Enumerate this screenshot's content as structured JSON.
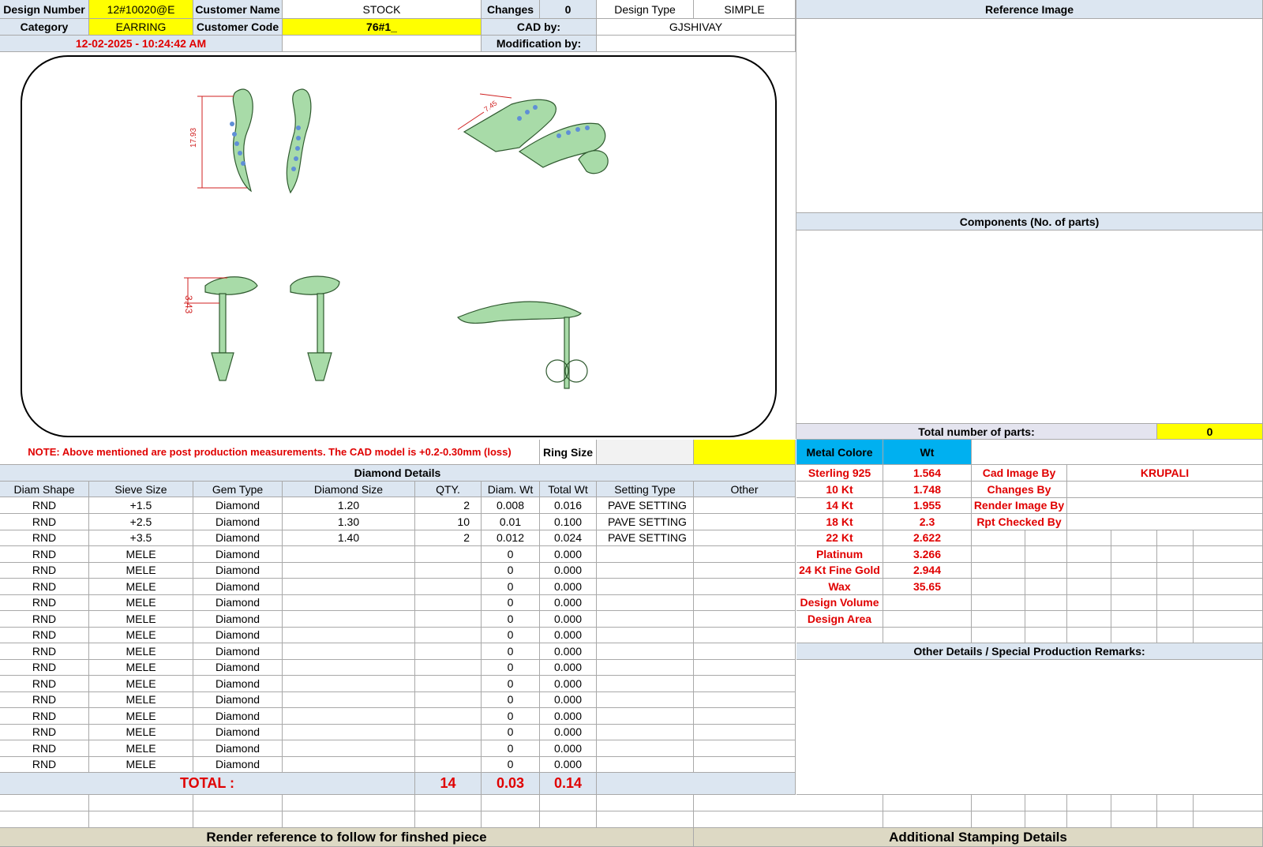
{
  "header": {
    "design_number_label": "Design Number",
    "design_number": "12#10020@E",
    "customer_name_label": "Customer Name",
    "customer_name": "STOCK",
    "changes_label": "Changes",
    "changes": "0",
    "design_type_label": "Design Type",
    "design_type": "SIMPLE",
    "category_label": "Category",
    "category": "EARRING",
    "customer_code_label": "Customer Code",
    "customer_code": "76#1_",
    "cad_by_label": "CAD by:",
    "cad_by": "GJSHIVAY",
    "timestamp": "12-02-2025 - 10:24:42 AM",
    "modification_by_label": "Modification by:"
  },
  "render": {
    "dim_front": "17.93",
    "dim_side": "3.43",
    "dim_angle": "7.45"
  },
  "right_panel": {
    "reference_image_title": "Reference Image",
    "components_title": "Components (No. of parts)",
    "total_parts_label": "Total number of parts:",
    "total_parts": "0"
  },
  "note": "NOTE: Above mentioned are post production measurements. The CAD model is +0.2-0.30mm (loss)",
  "ring_size_label": "Ring Size",
  "metal": {
    "header_label": "Metal Colore",
    "wt_label": "Wt",
    "rows": [
      {
        "name": "Sterling 925",
        "wt": "1.564"
      },
      {
        "name": "10 Kt",
        "wt": "1.748"
      },
      {
        "name": "14 Kt",
        "wt": "1.955"
      },
      {
        "name": "18 Kt",
        "wt": "2.3"
      },
      {
        "name": "22 Kt",
        "wt": "2.622"
      },
      {
        "name": "Platinum",
        "wt": "3.266"
      },
      {
        "name": "24 Kt Fine Gold",
        "wt": "2.944"
      },
      {
        "name": "Wax",
        "wt": "35.65"
      },
      {
        "name": "Design Volume",
        "wt": ""
      },
      {
        "name": "Design Area",
        "wt": ""
      }
    ]
  },
  "credits": [
    {
      "label": "Cad Image By",
      "value": "KRUPALI"
    },
    {
      "label": "Changes By",
      "value": ""
    },
    {
      "label": "Render Image By",
      "value": ""
    },
    {
      "label": "Rpt Checked By",
      "value": ""
    }
  ],
  "other_details_title": "Other Details / Special Production Remarks:",
  "diamond": {
    "title": "Diamond Details",
    "columns": [
      "Diam Shape",
      "Sieve Size",
      "Gem Type",
      "Diamond Size",
      "QTY.",
      "Diam. Wt",
      "Total Wt",
      "Setting Type",
      "Other"
    ],
    "rows": [
      [
        "RND",
        "+1.5",
        "Diamond",
        "1.20",
        "2",
        "0.008",
        "0.016",
        "PAVE SETTING",
        ""
      ],
      [
        "RND",
        "+2.5",
        "Diamond",
        "1.30",
        "10",
        "0.01",
        "0.100",
        "PAVE SETTING",
        ""
      ],
      [
        "RND",
        "+3.5",
        "Diamond",
        "1.40",
        "2",
        "0.012",
        "0.024",
        "PAVE SETTING",
        ""
      ],
      [
        "RND",
        "MELE",
        "Diamond",
        "",
        "",
        "0",
        "0.000",
        "",
        ""
      ],
      [
        "RND",
        "MELE",
        "Diamond",
        "",
        "",
        "0",
        "0.000",
        "",
        ""
      ],
      [
        "RND",
        "MELE",
        "Diamond",
        "",
        "",
        "0",
        "0.000",
        "",
        ""
      ],
      [
        "RND",
        "MELE",
        "Diamond",
        "",
        "",
        "0",
        "0.000",
        "",
        ""
      ],
      [
        "RND",
        "MELE",
        "Diamond",
        "",
        "",
        "0",
        "0.000",
        "",
        ""
      ],
      [
        "RND",
        "MELE",
        "Diamond",
        "",
        "",
        "0",
        "0.000",
        "",
        ""
      ],
      [
        "RND",
        "MELE",
        "Diamond",
        "",
        "",
        "0",
        "0.000",
        "",
        ""
      ],
      [
        "RND",
        "MELE",
        "Diamond",
        "",
        "",
        "0",
        "0.000",
        "",
        ""
      ],
      [
        "RND",
        "MELE",
        "Diamond",
        "",
        "",
        "0",
        "0.000",
        "",
        ""
      ],
      [
        "RND",
        "MELE",
        "Diamond",
        "",
        "",
        "0",
        "0.000",
        "",
        ""
      ],
      [
        "RND",
        "MELE",
        "Diamond",
        "",
        "",
        "0",
        "0.000",
        "",
        ""
      ],
      [
        "RND",
        "MELE",
        "Diamond",
        "",
        "",
        "0",
        "0.000",
        "",
        ""
      ],
      [
        "RND",
        "MELE",
        "Diamond",
        "",
        "",
        "0",
        "0.000",
        "",
        ""
      ],
      [
        "RND",
        "MELE",
        "Diamond",
        "",
        "",
        "0",
        "0.000",
        "",
        ""
      ]
    ],
    "total_label": "TOTAL :",
    "total_qty": "14",
    "total_diam_wt": "0.03",
    "total_wt": "0.14"
  },
  "footer": {
    "render_ref": "Render reference to follow for finshed piece",
    "stamping": "Additional Stamping Details"
  }
}
